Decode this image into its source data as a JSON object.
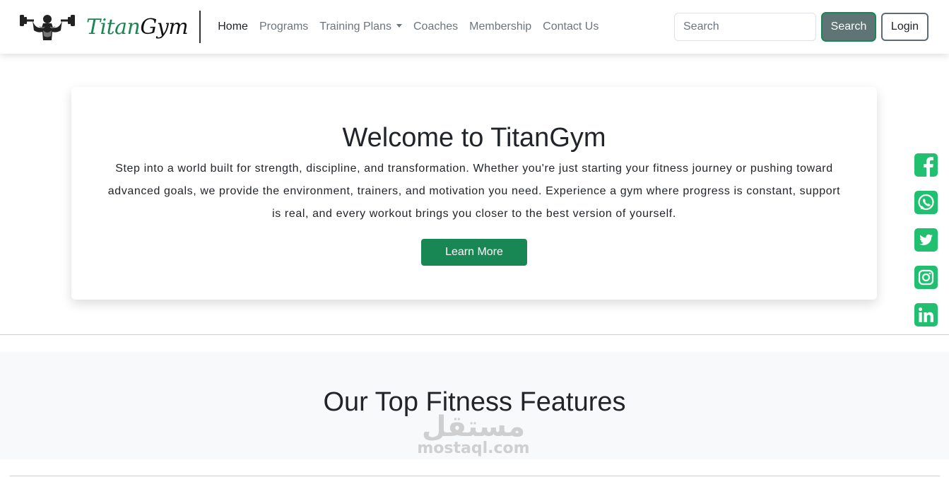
{
  "brand": {
    "name_part1": "Titan",
    "name_part2": "Gym"
  },
  "nav": {
    "items": [
      {
        "label": "Home",
        "active": true
      },
      {
        "label": "Programs"
      },
      {
        "label": "Training Plans",
        "dropdown": true
      },
      {
        "label": "Coaches"
      },
      {
        "label": "Membership"
      },
      {
        "label": "Contact Us"
      }
    ]
  },
  "search": {
    "placeholder": "Search",
    "button_label": "Search"
  },
  "login": {
    "label": "Login"
  },
  "hero": {
    "title": "Welcome to TitanGym",
    "text": "Step into a world built for strength, discipline, and transformation. Whether you're just starting your fitness journey or pushing toward advanced goals, we provide the environment, trainers, and motivation you need. Experience a gym where progress is constant, support is real, and every workout brings you closer to the best version of yourself.",
    "button_label": "Learn More"
  },
  "features": {
    "title": "Our Top Fitness Features"
  },
  "social": [
    {
      "icon": "facebook-icon"
    },
    {
      "icon": "whatsapp-icon"
    },
    {
      "icon": "twitter-icon"
    },
    {
      "icon": "instagram-icon"
    },
    {
      "icon": "linkedin-icon"
    }
  ],
  "watermark": {
    "arabic": "مستقل",
    "latin": "mostaql.com"
  },
  "colors": {
    "accent": "#198754",
    "social": "#20c070",
    "search_button": "#5f7474"
  }
}
